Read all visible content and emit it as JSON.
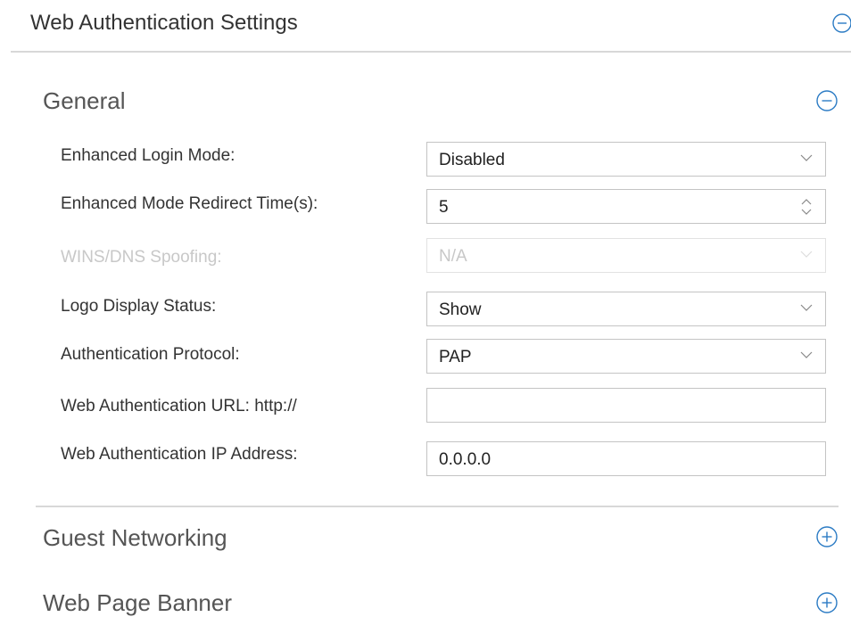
{
  "panel": {
    "title": "Web Authentication Settings",
    "toggle_icon": "collapse-circle-icon"
  },
  "general": {
    "title": "General",
    "toggle_icon": "collapse-circle-icon",
    "fields": {
      "enhanced_login_mode": {
        "label": "Enhanced Login Mode:",
        "value": "Disabled",
        "control": "select"
      },
      "redirect_time": {
        "label": "Enhanced Mode Redirect Time(s):",
        "value": "5",
        "control": "spinner"
      },
      "wins_dns_spoofing": {
        "label": "WINS/DNS Spoofing:",
        "value": "N/A",
        "control": "select",
        "disabled": true
      },
      "logo_display_status": {
        "label": "Logo Display Status:",
        "value": "Show",
        "control": "select"
      },
      "authentication_protocol": {
        "label": "Authentication Protocol:",
        "value": "PAP",
        "control": "select"
      },
      "web_auth_url": {
        "label": "Web Authentication URL: http://",
        "value": "",
        "control": "text"
      },
      "web_auth_ip": {
        "label": "Web Authentication IP Address:",
        "value": "0.0.0.0",
        "control": "text"
      }
    }
  },
  "guest_networking": {
    "title": "Guest Networking",
    "toggle_icon": "expand-circle-icon"
  },
  "web_page_banner": {
    "title": "Web Page Banner",
    "toggle_icon": "expand-circle-icon"
  },
  "colors": {
    "accent": "#2b7bc4",
    "disabled_text": "#c8c8c8",
    "border": "#c4c4c4"
  }
}
